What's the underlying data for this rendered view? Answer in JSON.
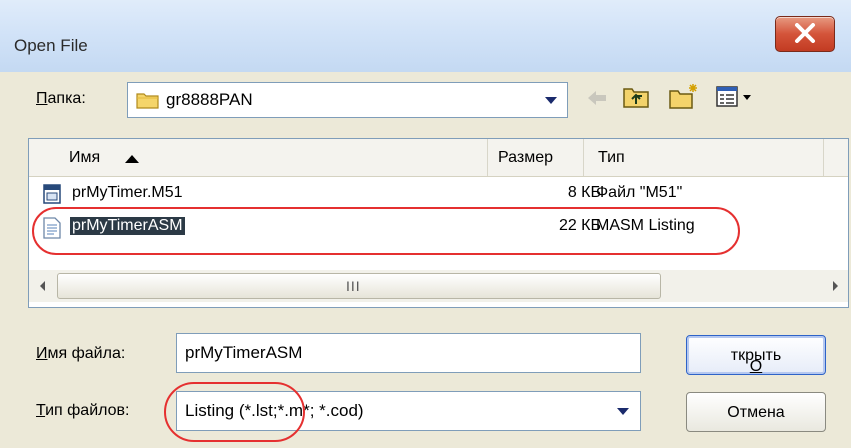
{
  "window": {
    "title": "Open File"
  },
  "folder": {
    "label": "Папка:",
    "value": "gr8888PAN"
  },
  "columns": {
    "name": "Имя",
    "size": "Размер",
    "type": "Тип"
  },
  "files": [
    {
      "name": "prMyTimer.M51",
      "size": "8 КБ",
      "type": "Файл \"M51\""
    },
    {
      "name": "prMyTimerASM",
      "size": "22 КБ",
      "type": "MASM Listing"
    }
  ],
  "scrollbar": {
    "grip": "III"
  },
  "filename": {
    "label": "Имя файла:",
    "value": "prMyTimerASM"
  },
  "filetype": {
    "label": "Тип файлов:",
    "value": "Listing (*.lst;*.m*; *.cod)"
  },
  "buttons": {
    "open": "Открыть",
    "cancel": "Отмена"
  },
  "colors": {
    "annotation": "#e53030",
    "selection": "#2c3a46",
    "title_bar": "#d2e3f8"
  }
}
